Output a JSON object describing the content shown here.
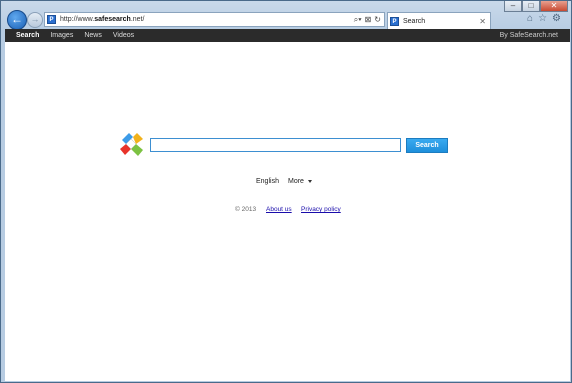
{
  "browser": {
    "address_url": "http://www.safesearch.net/",
    "address_url_prefix": "http://www.",
    "address_url_domain": "safesearch",
    "address_url_suffix": ".net/",
    "tab_title": "Search",
    "favicon_letter": "P"
  },
  "site": {
    "nav": {
      "items": [
        "Search",
        "Images",
        "News",
        "Videos"
      ],
      "active": "Search",
      "by_label": "By SafeSearch.net"
    },
    "search": {
      "input_value": "",
      "button_label": "Search"
    },
    "language": {
      "current": "English",
      "more_label": "More"
    },
    "footer": {
      "copyright": "© 2013",
      "about_label": "About us",
      "privacy_label": "Privacy policy"
    }
  },
  "colors": {
    "topbar_bg": "#2b2b2b",
    "search_button": "#1e8fdb",
    "search_border": "#3d8fd1",
    "link": "#1a0dab"
  }
}
